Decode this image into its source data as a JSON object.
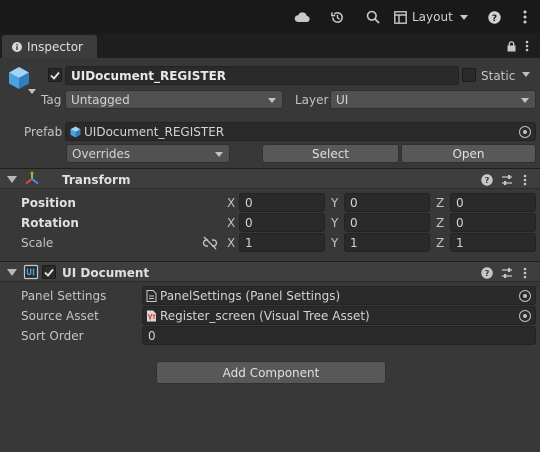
{
  "toolbar": {
    "layout_label": "Layout",
    "icons": [
      "cloud-icon",
      "history-icon",
      "search-icon",
      "layout-icon",
      "help-icon",
      "more-icon"
    ]
  },
  "tab": {
    "label": "Inspector"
  },
  "gameobject": {
    "name": "UIDocument_REGISTER",
    "active": true,
    "static_label": "Static",
    "tag_label": "Tag",
    "tag_value": "Untagged",
    "layer_label": "Layer",
    "layer_value": "UI",
    "prefab_label": "Prefab",
    "prefab_value": "UIDocument_REGISTER",
    "overrides_label": "Overrides",
    "select_label": "Select",
    "open_label": "Open"
  },
  "transform": {
    "title": "Transform",
    "rows": [
      {
        "label": "Position",
        "bold": true,
        "x": "0",
        "y": "0",
        "z": "0"
      },
      {
        "label": "Rotation",
        "bold": true,
        "x": "0",
        "y": "0",
        "z": "0"
      },
      {
        "label": "Scale",
        "bold": false,
        "x": "1",
        "y": "1",
        "z": "1"
      }
    ],
    "axis_x": "X",
    "axis_y": "Y",
    "axis_z": "Z"
  },
  "ui_document": {
    "title": "UI Document",
    "enabled": true,
    "panel_settings_label": "Panel Settings",
    "panel_settings_value": "PanelSettings (Panel Settings)",
    "source_asset_label": "Source Asset",
    "source_asset_value": "Register_screen (Visual Tree Asset)",
    "sort_order_label": "Sort Order",
    "sort_order_value": "0"
  },
  "add_component_label": "Add Component",
  "colors": {
    "accent_blue": "#4aa3df",
    "panel_bg": "#383838",
    "field_bg": "#2a2a2a"
  }
}
